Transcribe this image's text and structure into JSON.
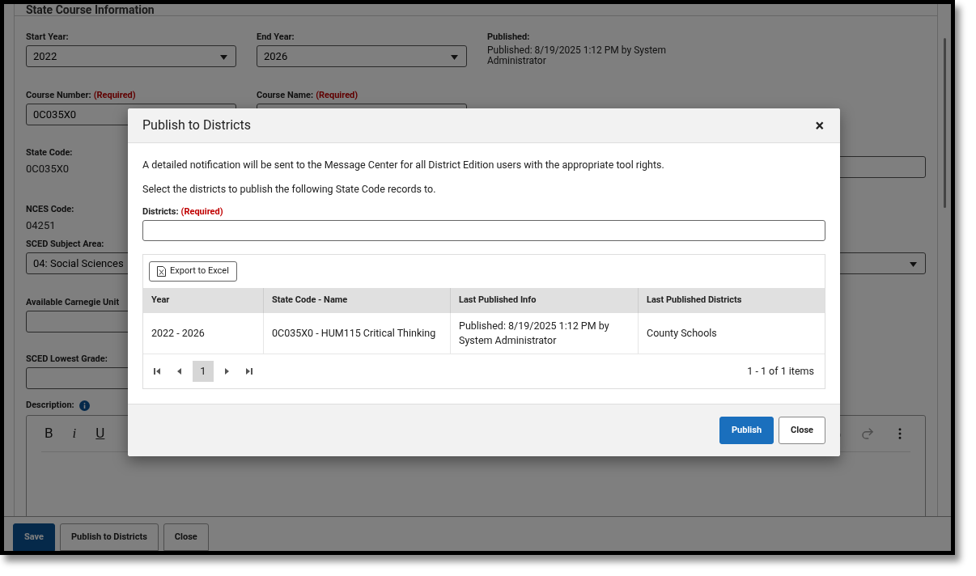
{
  "page_title": "State Course Information",
  "form": {
    "start_year": {
      "label": "Start Year:",
      "value": "2022"
    },
    "end_year": {
      "label": "End Year:",
      "value": "2026"
    },
    "published": {
      "label": "Published:",
      "value": "Published: 8/19/2025 1:12 PM by System Administrator"
    },
    "course_number": {
      "label": "Course Number:",
      "required": "(Required)",
      "value": "0C035X0"
    },
    "course_name": {
      "label": "Course Name:",
      "required": "(Required)"
    },
    "state_code": {
      "label": "State Code:",
      "value": "0C035X0"
    },
    "nces_code": {
      "label": "NCES Code:",
      "value": "04251"
    },
    "sced_subject_area": {
      "label": "SCED Subject Area:",
      "value": "04: Social Sciences"
    },
    "carnegie_unit": {
      "label": "Available Carnegie Unit"
    },
    "sced_lowest_grade": {
      "label": "SCED Lowest Grade:"
    },
    "description": {
      "label": "Description:",
      "toolbar": [
        "B",
        "i",
        "U"
      ]
    }
  },
  "footer_buttons": [
    {
      "label": "Save",
      "kind": "primary"
    },
    {
      "label": "Publish to Districts",
      "kind": "default"
    },
    {
      "label": "Close",
      "kind": "default"
    }
  ],
  "dialog": {
    "title": "Publish to Districts",
    "close": "×",
    "notice": "A detailed notification will be sent to the Message Center for all District Edition users with the appropriate tool rights.",
    "instruction": "Select the districts to publish the following State Code records to.",
    "districts": {
      "label": "Districts:",
      "required": "(Required)"
    },
    "export_button": "Export to Excel",
    "table": {
      "columns": [
        "Year",
        "State Code - Name",
        "Last Published Info",
        "Last Published Districts"
      ],
      "rows": [
        [
          "2022 - 2026",
          "0C035X0 - HUM115 Critical Thinking",
          "Published: 8/19/2025 1:12 PM by System Administrator",
          "County Schools"
        ]
      ]
    },
    "pager": {
      "pages": [
        {
          "label": "1",
          "selected": true
        }
      ],
      "summary": "1 - 1 of 1 items"
    },
    "buttons": [
      {
        "label": "Publish",
        "kind": "primary"
      },
      {
        "label": "Close",
        "kind": "default"
      }
    ]
  }
}
